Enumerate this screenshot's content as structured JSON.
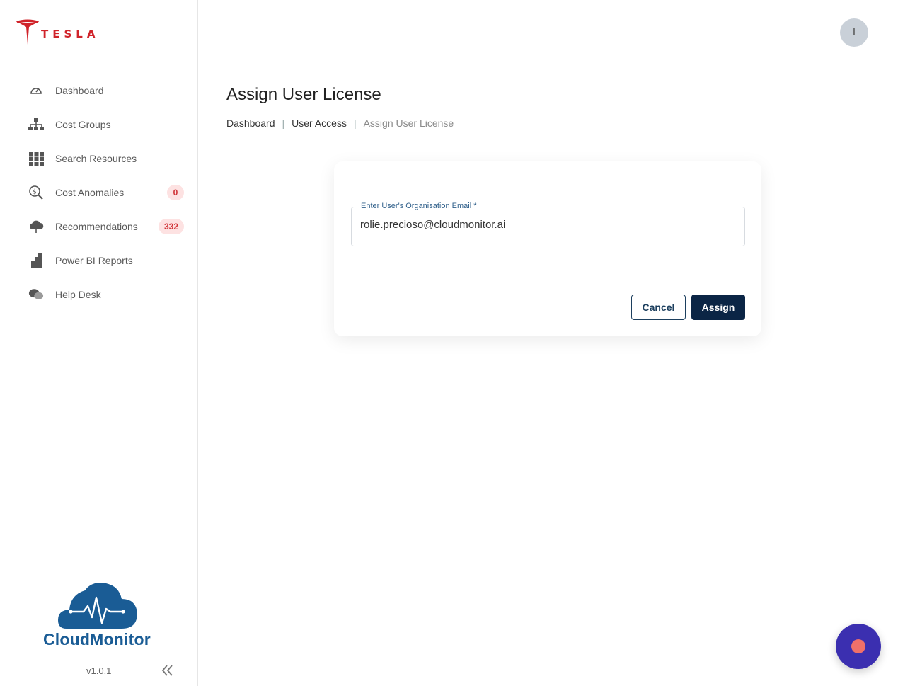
{
  "brand": {
    "name": "TESLA",
    "color": "#d0232a"
  },
  "sidebar": {
    "items": [
      {
        "label": "Dashboard",
        "icon": "gauge-icon"
      },
      {
        "label": "Cost Groups",
        "icon": "hierarchy-icon"
      },
      {
        "label": "Search Resources",
        "icon": "grid-icon"
      },
      {
        "label": "Cost Anomalies",
        "icon": "dollar-search-icon",
        "badge": "0"
      },
      {
        "label": "Recommendations",
        "icon": "cloud-icon",
        "badge": "332"
      },
      {
        "label": "Power BI Reports",
        "icon": "bar-chart-icon"
      },
      {
        "label": "Help Desk",
        "icon": "chat-icon"
      }
    ],
    "product_name": "CloudMonitor",
    "version": "v1.0.1"
  },
  "header": {
    "avatar_initial": "I"
  },
  "page": {
    "title": "Assign User License",
    "breadcrumb": [
      "Dashboard",
      "User Access",
      "Assign User License"
    ]
  },
  "form": {
    "email_label": "Enter User's Organisation Email *",
    "email_value": "rolie.precioso@cloudmonitor.ai",
    "cancel_label": "Cancel",
    "assign_label": "Assign"
  },
  "colors": {
    "primary": "#0b2545",
    "badge_bg": "#fde2e2",
    "badge_text": "#d13438",
    "fab": "#3b2fb0"
  }
}
